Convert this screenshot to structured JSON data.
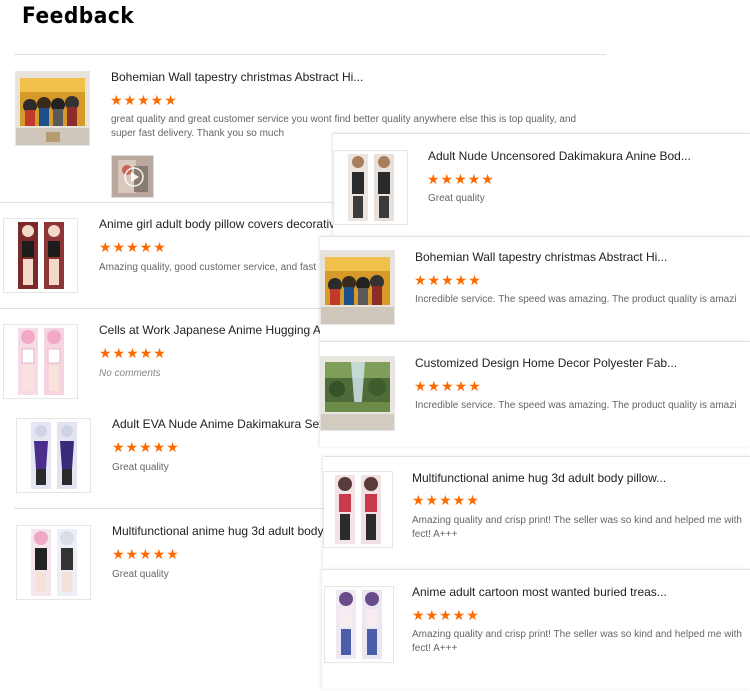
{
  "header": {
    "title": "Feedback"
  },
  "left_reviews": [
    {
      "product": "Bohemian Wall tapestry christmas Abstract Hi...",
      "stars": "★★★★★",
      "comment": "great quality and great customer service you wont find better quality anywhere else this is top quality,  and super fast delivery. Thank you so much"
    },
    {
      "product": "Anime girl adult body pillow covers decorative",
      "stars": "★★★★★",
      "comment": "Amazing quality, good customer service, and fast"
    },
    {
      "product": "Cells at Work Japanese Anime Hugging Ac",
      "stars": "★★★★★",
      "comment": "No comments"
    },
    {
      "product": "Adult EVA Nude Anime Dakimakura Sexy",
      "stars": "★★★★★",
      "comment": "Great quality"
    },
    {
      "product": "Multifunctional anime hug 3d adult body",
      "stars": "★★★★★",
      "comment": "Great quality"
    }
  ],
  "right_reviews": [
    {
      "product": "Adult Nude Uncensored Dakimakura Anine Bod...",
      "stars": "★★★★★",
      "comment": "Great quality"
    },
    {
      "product": "Bohemian Wall tapestry christmas Abstract Hi...",
      "stars": "★★★★★",
      "comment": "Incredible service.  The speed was amazing.  The product quality is amazi"
    },
    {
      "product": "Customized Design Home Decor Polyester Fab...",
      "stars": "★★★★★",
      "comment": "Incredible service.  The speed was amazing.  The product quality is amazi"
    },
    {
      "product": "Multifunctional anime hug 3d adult body pillow...",
      "stars": "★★★★★",
      "comment_line1": "Amazing quality and crisp print! The seller was so kind and helped me with",
      "comment_line2": "fect! A+++"
    },
    {
      "product": "Anime adult cartoon most wanted buried treas...",
      "stars": "★★★★★",
      "comment_line1": "Amazing quality and crisp print! The seller was so kind and helped me with",
      "comment_line2": "fect! A+++"
    }
  ]
}
